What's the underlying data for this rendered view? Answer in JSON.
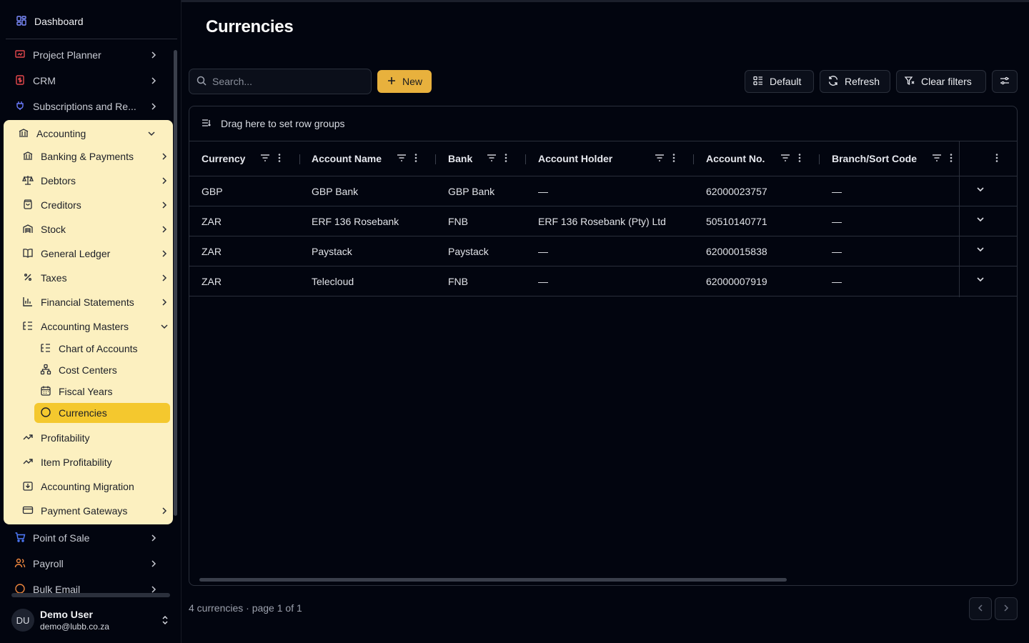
{
  "sidebar": {
    "dashboard": "Dashboard",
    "top_items": [
      {
        "label": "Project Planner",
        "icon": "presentation-chart-icon",
        "color": "#e5484d"
      },
      {
        "label": "CRM",
        "icon": "dollar-badge-icon",
        "color": "#e5484d"
      },
      {
        "label": "Subscriptions and Re...",
        "icon": "plug-icon",
        "color": "#6b7cff"
      }
    ],
    "accounting": {
      "label": "Accounting",
      "items": [
        {
          "label": "Banking & Payments",
          "icon": "bank-icon"
        },
        {
          "label": "Debtors",
          "icon": "scale-icon"
        },
        {
          "label": "Creditors",
          "icon": "shopping-bag-icon"
        },
        {
          "label": "Stock",
          "icon": "warehouse-icon"
        },
        {
          "label": "General Ledger",
          "icon": "book-open-icon"
        },
        {
          "label": "Taxes",
          "icon": "percent-icon"
        },
        {
          "label": "Financial Statements",
          "icon": "bar-chart-icon"
        },
        {
          "label": "Accounting Masters",
          "icon": "list-tree-icon"
        }
      ],
      "masters": [
        {
          "label": "Chart of Accounts",
          "icon": "list-tree-icon"
        },
        {
          "label": "Cost Centers",
          "icon": "network-icon"
        },
        {
          "label": "Fiscal Years",
          "icon": "calendar-icon"
        },
        {
          "label": "Currencies",
          "icon": "circle-icon"
        }
      ],
      "bottom": [
        {
          "label": "Profitability",
          "icon": "trend-up-icon"
        },
        {
          "label": "Item Profitability",
          "icon": "trend-up-icon"
        },
        {
          "label": "Accounting Migration",
          "icon": "import-icon"
        },
        {
          "label": "Payment Gateways",
          "icon": "credit-card-icon"
        }
      ]
    },
    "after_items": [
      {
        "label": "Point of Sale",
        "icon": "cart-icon",
        "color": "#4f7cff"
      },
      {
        "label": "Payroll",
        "icon": "users-icon",
        "color": "#f0883e"
      },
      {
        "label": "Bulk Email",
        "icon": "circle-icon",
        "color": "#f0883e"
      }
    ],
    "user": {
      "initials": "DU",
      "name": "Demo User",
      "email": "demo@lubb.co.za"
    }
  },
  "page": {
    "title": "Currencies",
    "search_placeholder": "Search...",
    "new_label": "New",
    "default_label": "Default",
    "refresh_label": "Refresh",
    "clear_filters_label": "Clear filters",
    "row_groups_hint": "Drag here to set row groups",
    "footer": "4 currencies · page 1 of 1"
  },
  "table": {
    "columns": [
      "Currency",
      "Account Name",
      "Bank",
      "Account Holder",
      "Account No.",
      "Branch/Sort Code"
    ],
    "rows": [
      [
        "GBP",
        "GBP Bank",
        "GBP Bank",
        "—",
        "62000023757",
        "—"
      ],
      [
        "ZAR",
        "ERF 136 Rosebank",
        "FNB",
        "ERF 136 Rosebank (Pty) Ltd",
        "50510140771",
        "—"
      ],
      [
        "ZAR",
        "Paystack",
        "Paystack",
        "—",
        "62000015838",
        "—"
      ],
      [
        "ZAR",
        "Telecloud",
        "FNB",
        "—",
        "62000007919",
        "—"
      ]
    ]
  },
  "colors": {
    "accent": "#e8b13d",
    "active_nav": "#f4c82e",
    "panel": "#fcf0c0",
    "background": "#02050f"
  }
}
